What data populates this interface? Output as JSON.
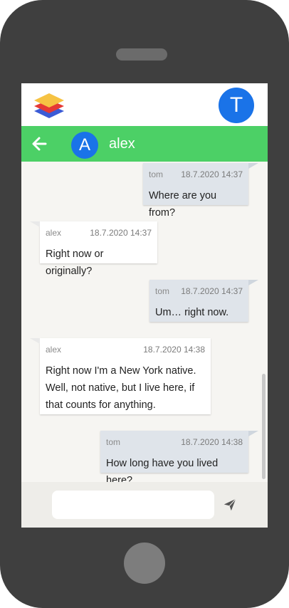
{
  "app": {
    "user_initial": "T"
  },
  "chat": {
    "contact_initial": "A",
    "contact_name": "alex"
  },
  "messages": [
    {
      "direction": "out",
      "author": "tom",
      "time": "18.7.2020 14:37",
      "text": "Where are you from?"
    },
    {
      "direction": "in",
      "author": "alex",
      "time": "18.7.2020 14:37",
      "text": "Right now or originally?"
    },
    {
      "direction": "out",
      "author": "tom",
      "time": "18.7.2020 14:37",
      "text": "Um… right now."
    },
    {
      "direction": "in",
      "author": "alex",
      "time": "18.7.2020 14:38",
      "text": "Right now I'm a New York native. Well, not native, but I live here, if that counts for anything."
    },
    {
      "direction": "out",
      "author": "tom",
      "time": "18.7.2020 14:38",
      "text": "How long have you lived here?"
    }
  ],
  "composer": {
    "placeholder": "",
    "value": ""
  },
  "colors": {
    "chat_bar": "#4cd066",
    "avatar": "#1a73e8",
    "outgoing_bubble": "#dfe4ea",
    "incoming_bubble": "#ffffff",
    "background": "#f6f5f2"
  },
  "icons": {
    "logo": "stacked-layers-icon",
    "back": "arrow-left-icon",
    "send": "paper-plane-icon"
  }
}
